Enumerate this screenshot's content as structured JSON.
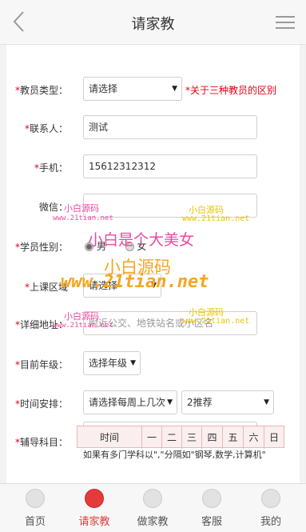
{
  "header": {
    "title": "请家教"
  },
  "form": {
    "teacher_type": {
      "label": "教员类型：",
      "value": "请选择",
      "note": "*关于三种教员的区别"
    },
    "contact": {
      "label": "联系人：",
      "value": "测试"
    },
    "phone": {
      "label": "手机：",
      "value": "15612312312"
    },
    "wechat": {
      "label": "微信："
    },
    "gender": {
      "label": "学员性别：",
      "male": "男",
      "female": "女"
    },
    "area": {
      "label": "上课区域",
      "value": "请选择"
    },
    "address": {
      "label": "详细地址：",
      "placeholder": "附近公交、地铁站名或小区名"
    },
    "grade": {
      "label": "目前年级：",
      "value": "选择年级"
    },
    "schedule": {
      "label": "时间安排：",
      "times_value": "请选择每周上几次",
      "recommend_value": "2推荐"
    },
    "subject": {
      "label": "辅导科目：",
      "hint": "如果有多门学科以\",\"分隔如\"钢琴,数学,计算机\""
    },
    "schedule_table": {
      "headers": [
        "时间",
        "一",
        "二",
        "三",
        "四",
        "五",
        "六",
        "日"
      ]
    }
  },
  "watermarks": {
    "brand_small_a": "小白源码",
    "url_small_a": "www.21tian.net",
    "brand_small_b": "小白源码",
    "url_small_b": "www.21tian.net",
    "slogan": "小白是个大美女",
    "brand_large": "小白源码",
    "url_large": "www.21tian.net",
    "brand_small_c": "小白源码",
    "url_small_c": "www.21tian.net",
    "brand_small_d": "小白源码",
    "url_small_d": "www.21tian.net"
  },
  "footer": {
    "items": [
      {
        "label": "首页",
        "icon": "home-icon"
      },
      {
        "label": "请家教",
        "icon": "person-search-icon",
        "active": true
      },
      {
        "label": "做家教",
        "icon": "group-icon"
      },
      {
        "label": "客服",
        "icon": "headset-icon"
      },
      {
        "label": "我的",
        "icon": "user-icon"
      }
    ]
  },
  "colors": {
    "required": "#e60012",
    "active_tab": "#e33b3b",
    "watermark_pink": "#e84aa0",
    "watermark_orange": "#f5a623",
    "watermark_yellow": "#e9c400"
  }
}
